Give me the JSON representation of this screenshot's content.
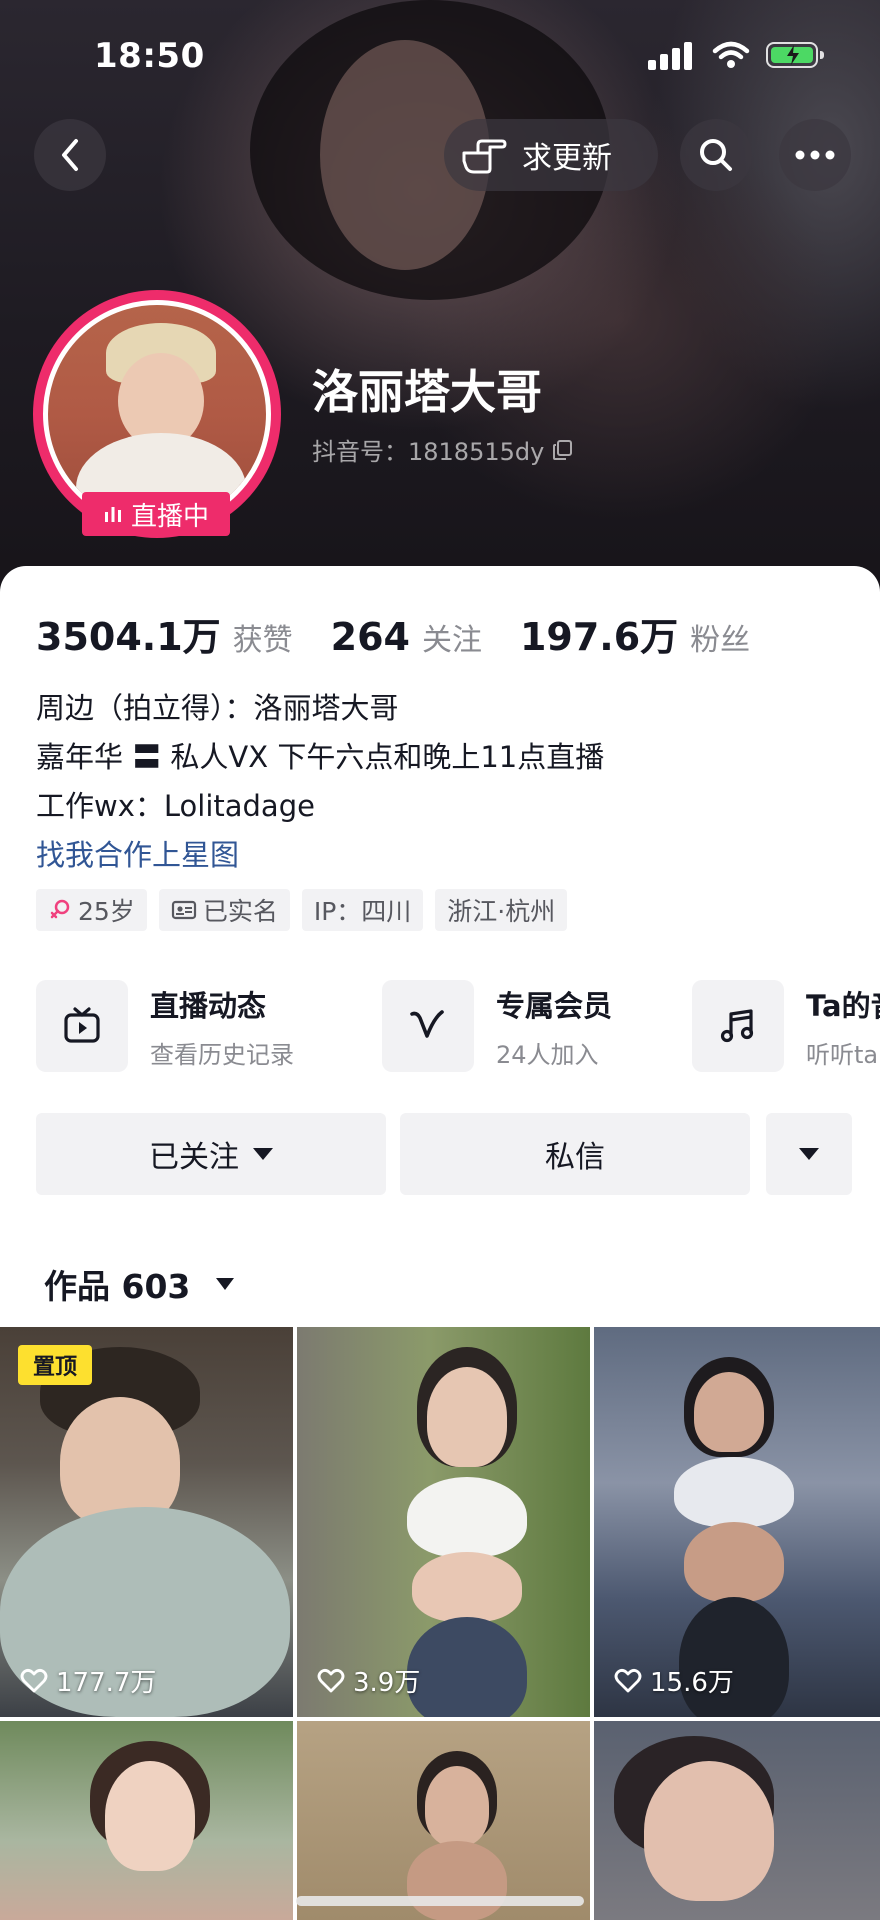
{
  "status_bar": {
    "time": "18:50"
  },
  "header": {
    "request_update_label": "求更新",
    "username": "洛丽塔大哥",
    "douyin_id": "抖音号：1818515dy",
    "live_badge": "直播中"
  },
  "stats": [
    {
      "value": "3504.1万",
      "label": "获赞"
    },
    {
      "value": "264",
      "label": "关注"
    },
    {
      "value": "197.6万",
      "label": "粉丝"
    }
  ],
  "bio": {
    "lines": [
      "周边（拍立得）：洛丽塔大哥",
      "嘉年华 〓 私人VX 下午六点和晚上11点直播",
      "工作wx：Lolitadage"
    ],
    "link": "找我合作上星图"
  },
  "tags": [
    {
      "icon": "female-icon",
      "text": "25岁"
    },
    {
      "icon": "id-card-icon",
      "text": "已实名"
    },
    {
      "icon": "",
      "text": "IP：四川"
    },
    {
      "icon": "",
      "text": "浙江·杭州"
    }
  ],
  "features": [
    {
      "icon": "tv-icon",
      "title": "直播动态",
      "subtitle": "查看历史记录"
    },
    {
      "icon": "vip-v-icon",
      "title": "专属会员",
      "subtitle": "24人加入"
    },
    {
      "icon": "music-note-icon",
      "title": "Ta的音",
      "subtitle": "听听ta"
    }
  ],
  "actions": {
    "follow_label": "已关注",
    "message_label": "私信"
  },
  "works": {
    "label": "作品 603",
    "pinned_label": "置顶",
    "items": [
      {
        "likes": "177.7万"
      },
      {
        "likes": "3.9万"
      },
      {
        "likes": "15.6万"
      },
      {
        "likes": ""
      },
      {
        "likes": ""
      },
      {
        "likes": ""
      }
    ]
  },
  "colors": {
    "accent_pink": "#ee2c6b",
    "link_blue": "#315695",
    "pinned_yellow": "#fde02f",
    "battery_green": "#4cd964"
  }
}
